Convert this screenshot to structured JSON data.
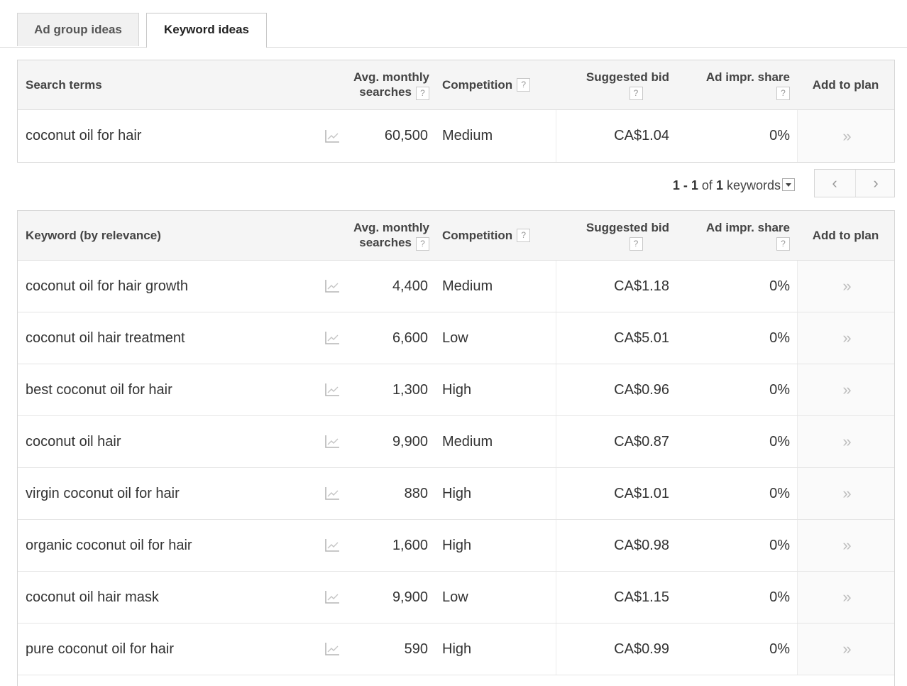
{
  "tabs": [
    {
      "label": "Ad group ideas",
      "active": false
    },
    {
      "label": "Keyword ideas",
      "active": true
    }
  ],
  "search_table": {
    "headers": {
      "term": "Search terms",
      "avg_line1": "Avg. monthly",
      "avg_line2": "searches",
      "competition": "Competition",
      "bid": "Suggested bid",
      "share": "Ad impr. share",
      "add": "Add to plan",
      "help": "?"
    },
    "rows": [
      {
        "term": "coconut oil for hair",
        "avg": "60,500",
        "competition": "Medium",
        "bid": "CA$1.04",
        "share": "0%"
      }
    ]
  },
  "pagination": {
    "range": "1 - 1",
    "of": "of",
    "total": "1",
    "unit": "keywords",
    "prev": "‹",
    "next": "›"
  },
  "keyword_table": {
    "headers": {
      "term": "Keyword (by relevance)",
      "avg_line1": "Avg. monthly",
      "avg_line2": "searches",
      "competition": "Competition",
      "bid": "Suggested bid",
      "share": "Ad impr. share",
      "add": "Add to plan",
      "help": "?"
    },
    "rows": [
      {
        "term": "coconut oil for hair growth",
        "avg": "4,400",
        "competition": "Medium",
        "bid": "CA$1.18",
        "share": "0%"
      },
      {
        "term": "coconut oil hair treatment",
        "avg": "6,600",
        "competition": "Low",
        "bid": "CA$5.01",
        "share": "0%"
      },
      {
        "term": "best coconut oil for hair",
        "avg": "1,300",
        "competition": "High",
        "bid": "CA$0.96",
        "share": "0%"
      },
      {
        "term": "coconut oil hair",
        "avg": "9,900",
        "competition": "Medium",
        "bid": "CA$0.87",
        "share": "0%"
      },
      {
        "term": "virgin coconut oil for hair",
        "avg": "880",
        "competition": "High",
        "bid": "CA$1.01",
        "share": "0%"
      },
      {
        "term": "organic coconut oil for hair",
        "avg": "1,600",
        "competition": "High",
        "bid": "CA$0.98",
        "share": "0%"
      },
      {
        "term": "coconut oil hair mask",
        "avg": "9,900",
        "competition": "Low",
        "bid": "CA$1.15",
        "share": "0%"
      },
      {
        "term": "pure coconut oil for hair",
        "avg": "590",
        "competition": "High",
        "bid": "CA$0.99",
        "share": "0%"
      }
    ]
  },
  "icons": {
    "trend": "trend-chart-icon",
    "add": "double-chevron-right-icon",
    "add_glyph": "»"
  },
  "colors": {
    "header_bg": "#f5f5f5",
    "border": "#d6d6d6",
    "chevron": "#bdbdbd"
  }
}
